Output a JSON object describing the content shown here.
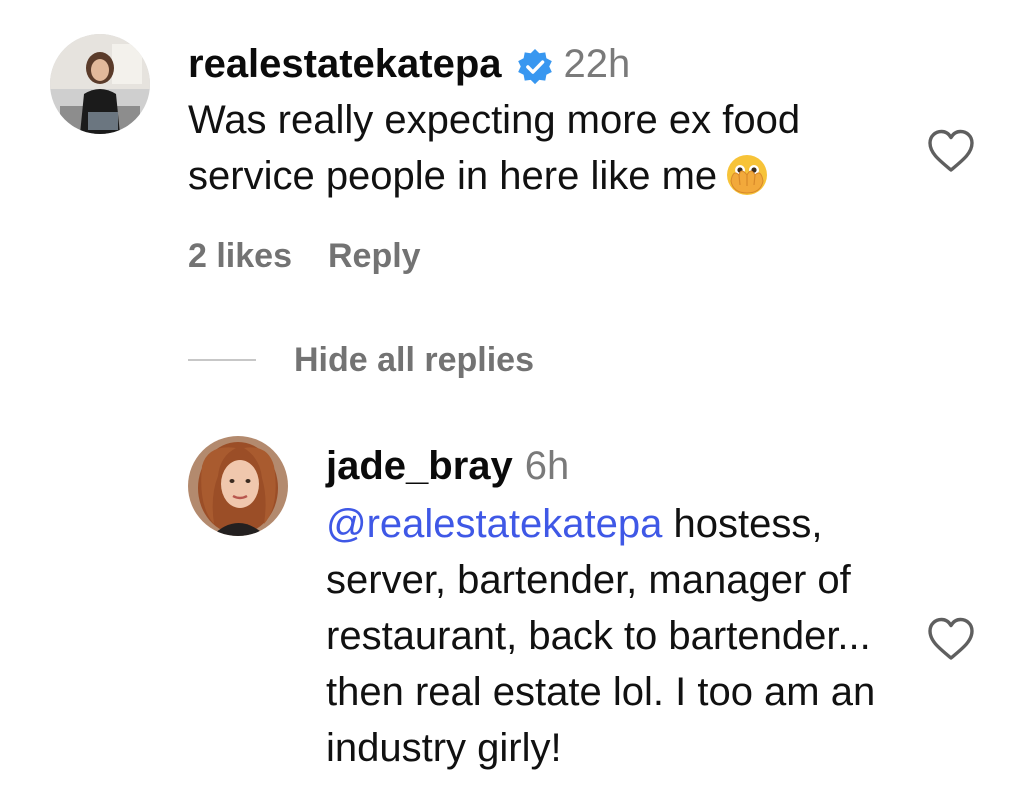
{
  "comments": [
    {
      "username": "realestatekatepa",
      "verified": true,
      "time": "22h",
      "text_lines": [
        "Was really expecting more ex food",
        "service people in here like me"
      ],
      "emoji": "face-with-open-eyes-and-hand-over-mouth",
      "likes_label": "2 likes",
      "reply_label": "Reply"
    }
  ],
  "replies_toggle": "Hide all replies",
  "replies": [
    {
      "username": "jade_bray",
      "time": "6h",
      "mention": "@realestatekatepa",
      "text_lines": [
        " hostess,",
        "server, bartender, manager of",
        "restaurant, back to bartender...",
        "then real estate lol. I too am an",
        "industry girly!"
      ]
    }
  ],
  "colors": {
    "username": "#0b0b0b",
    "muted": "#737373",
    "mention": "#3f58e6",
    "verified": "#3897f0"
  },
  "icons": {
    "like": "heart-outline-icon",
    "verified": "verified-badge-icon"
  }
}
